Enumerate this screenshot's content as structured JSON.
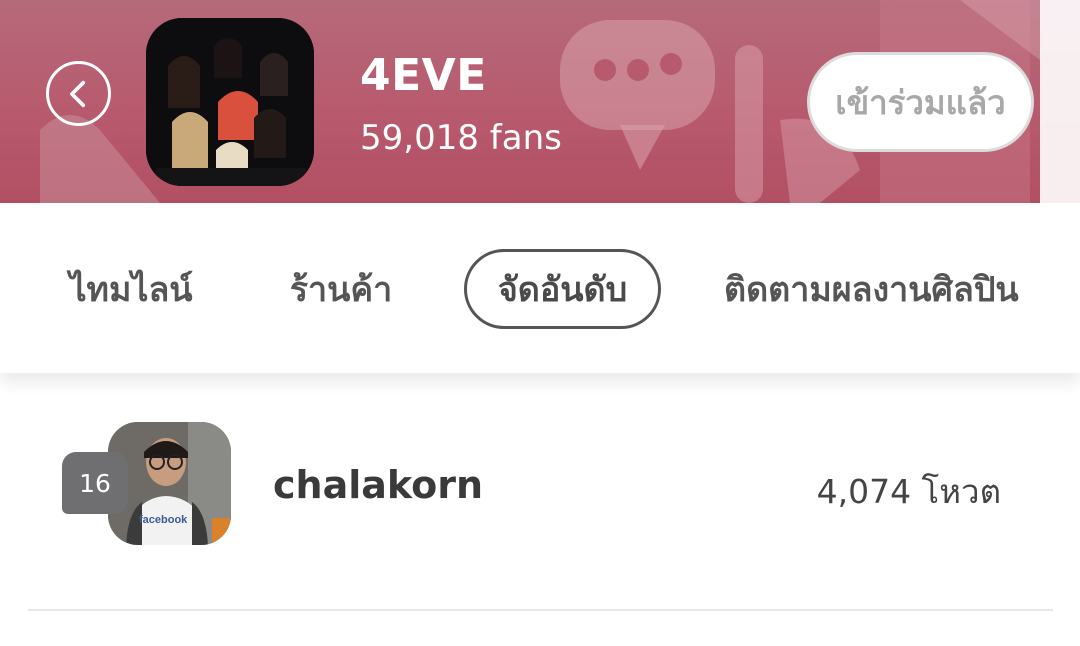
{
  "header": {
    "group_name": "4EVE",
    "fan_count": "59,018 fans",
    "join_label": "เข้าร่วมแล้ว",
    "back_icon": "chevron-left-icon",
    "background_color": "#b85a6e"
  },
  "tabs": [
    {
      "label": "ไทมไลน์",
      "active": false
    },
    {
      "label": "ร้านค้า",
      "active": false
    },
    {
      "label": "จัดอันดับ",
      "active": true
    },
    {
      "label": "ติดตามผลงานศิลปิน",
      "active": false
    }
  ],
  "ranking": [
    {
      "rank": "16",
      "username": "chalakorn",
      "votes": "4,074 โหวต"
    }
  ]
}
